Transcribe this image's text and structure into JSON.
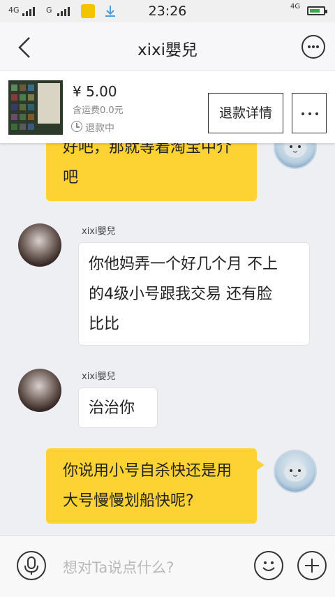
{
  "status_bar": {
    "time": "23:26",
    "network1": "4G",
    "network2": "G",
    "network3": "4G"
  },
  "nav": {
    "title": "xixi嬰兒"
  },
  "product": {
    "price": "¥ 5.00",
    "shipping": "含运费0.0元",
    "status": "退款中",
    "refund_button": "退款详情"
  },
  "messages": [
    {
      "from": "me",
      "text_line1": "好吧，那就等着淘宝中介",
      "text_line2": "吧"
    },
    {
      "from": "other",
      "sender": "xixi嬰兒",
      "text_line1": "你他妈弄一个好几个月 不上",
      "text_line2": "的4级小号跟我交易 还有脸",
      "text_line3": "比比"
    },
    {
      "from": "other",
      "sender": "xixi嬰兒",
      "text_line1": "治治你"
    },
    {
      "from": "me",
      "text_line1": "你说用小号自杀快还是用",
      "text_line2": "大号慢慢划船快呢?"
    }
  ],
  "input": {
    "placeholder": "想对Ta说点什么?"
  },
  "colors": {
    "my_bubble": "#fdd333",
    "their_bubble": "#ffffff",
    "background": "#eeeff3"
  },
  "icons": {
    "back": "chevron-left-icon",
    "more": "more-dots-icon",
    "voice": "microphone-icon",
    "emoji": "smiley-icon",
    "add": "plus-icon"
  }
}
